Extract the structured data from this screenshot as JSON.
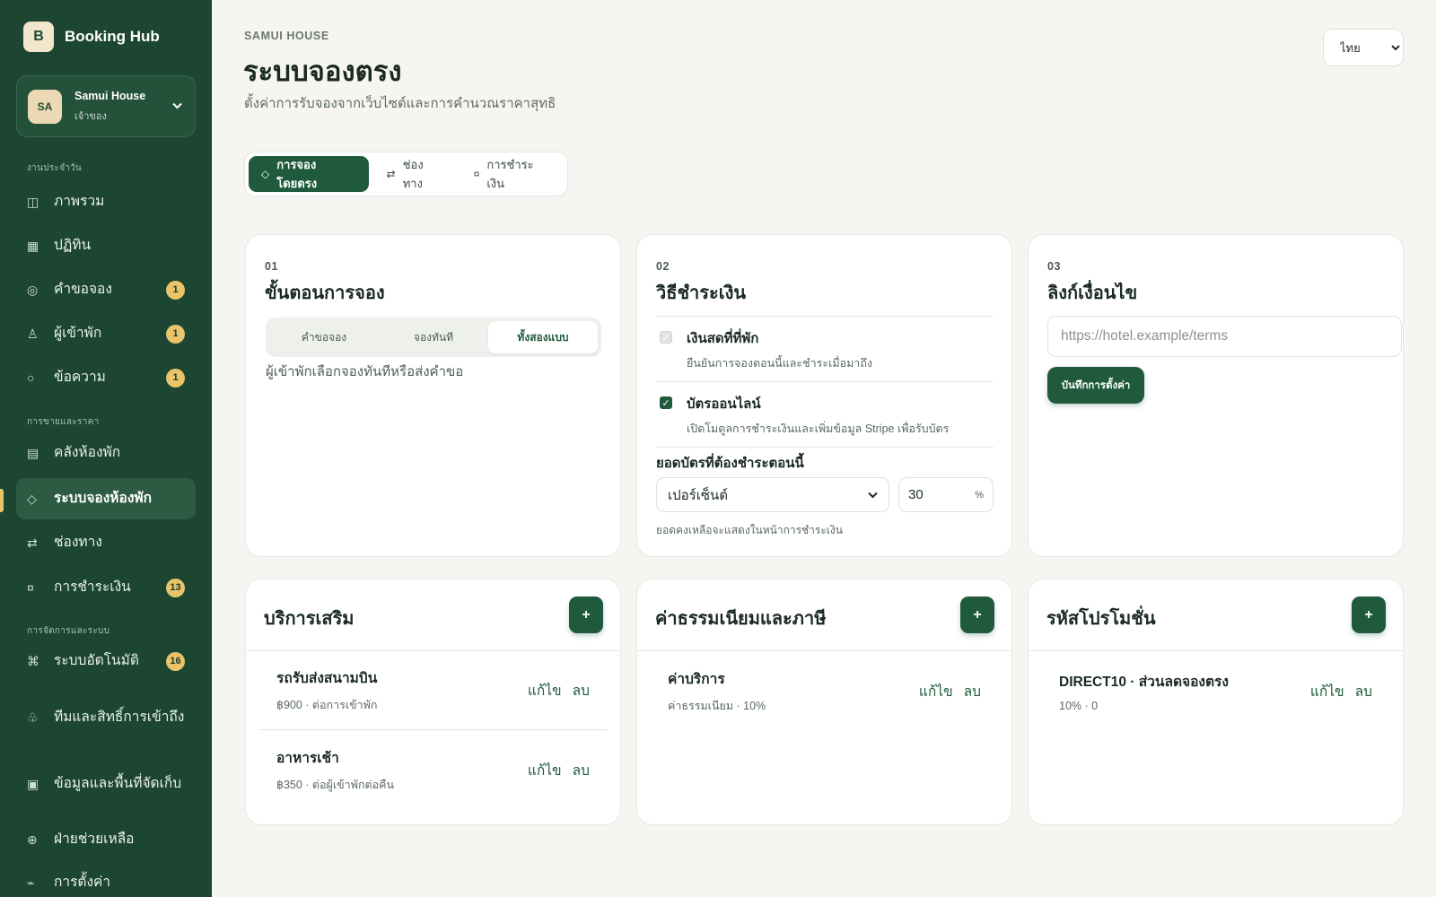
{
  "brand": {
    "logo_letter": "B",
    "name": "Booking Hub"
  },
  "account": {
    "initials": "SA",
    "name": "Samui House",
    "role": "เจ้าของ"
  },
  "sidebar": {
    "sections": [
      "งานประจำวัน",
      "การขายและราคา",
      "การจัดการและระบบ"
    ],
    "items": [
      {
        "label": "ภาพรวม",
        "icon": "◫"
      },
      {
        "label": "ปฏิทิน",
        "icon": "▦"
      },
      {
        "label": "คำขอจอง",
        "icon": "◎",
        "badge": "1"
      },
      {
        "label": "ผู้เข้าพัก",
        "icon": "♙",
        "badge": "1"
      },
      {
        "label": "ข้อความ",
        "icon": "○",
        "badge": "1"
      },
      {
        "label": "คลังห้องพัก",
        "icon": "▤"
      },
      {
        "label": "ระบบจองห้องพัก",
        "icon": "◇"
      },
      {
        "label": "ช่องทาง",
        "icon": "⇄"
      },
      {
        "label": "การชำระเงิน",
        "icon": "¤",
        "badge": "13"
      },
      {
        "label": "ระบบอัตโนมัติ",
        "icon": "⌘",
        "badge": "16"
      },
      {
        "label": "ทีมและสิทธิ์การเข้าถึง",
        "icon": "♧"
      },
      {
        "label": "ข้อมูลและพื้นที่จัดเก็บ",
        "icon": "▣"
      },
      {
        "label": "ฝ่ายช่วยเหลือ",
        "icon": "⊕"
      },
      {
        "label": "การตั้งค่า",
        "icon": "⌁"
      }
    ]
  },
  "header": {
    "eyebrow": "SAMUI HOUSE",
    "title": "ระบบจองตรง",
    "subtitle": "ตั้งค่าการรับจองจากเว็บไซต์และการคำนวณราคาสุทธิ",
    "language": "ไทย"
  },
  "tabs": [
    {
      "label": "การจองโดยตรง",
      "icon": "◇"
    },
    {
      "label": "ช่องทาง",
      "icon": "⇄"
    },
    {
      "label": "การชำระเงิน",
      "icon": "¤"
    }
  ],
  "flow_card": {
    "num": "01",
    "title": "ขั้นตอนการจอง",
    "options": [
      "คำขอจอง",
      "จองทันที",
      "ทั้งสองแบบ"
    ],
    "selected_index": 2,
    "note": "ผู้เข้าพักเลือกจองทันทีหรือส่งคำขอ"
  },
  "payment_card": {
    "num": "02",
    "title": "วิธีชำระเงิน",
    "methods": [
      {
        "name": "เงินสดที่ที่พัก",
        "desc": "ยืนยันการจองตอนนี้และชำระเมื่อมาถึง",
        "checked": true,
        "disabled": true
      },
      {
        "name": "บัตรออนไลน์",
        "desc": "เปิดโมดูลการชำระเงินและเพิ่มข้อมูล Stripe เพื่อรับบัตร",
        "checked": true,
        "disabled": false
      }
    ],
    "due_label": "ยอดบัตรที่ต้องชำระตอนนี้",
    "due_type": "เปอร์เซ็นต์",
    "due_value": "30",
    "due_unit": "%",
    "due_note": "ยอดคงเหลือจะแสดงในหน้าการชำระเงิน"
  },
  "terms_card": {
    "num": "03",
    "title": "ลิงก์เงื่อนไข",
    "placeholder": "https://hotel.example/terms",
    "save_label": "บันทึกการตั้งค่า"
  },
  "lists": [
    {
      "title": "บริการเสริม",
      "add_label": "+",
      "rows": [
        {
          "name": "รถรับส่งสนามบิน",
          "desc": "฿900 · ต่อการเข้าพัก"
        },
        {
          "name": "อาหารเช้า",
          "desc": "฿350 · ต่อผู้เข้าพักต่อคืน"
        }
      ]
    },
    {
      "title": "ค่าธรรมเนียมและภาษี",
      "add_label": "+",
      "rows": [
        {
          "name": "ค่าบริการ",
          "desc": "ค่าธรรมเนียม · 10%"
        }
      ]
    },
    {
      "title": "รหัสโปรโมชั่น",
      "add_label": "+",
      "rows": [
        {
          "name": "DIRECT10 · ส่วนลดจองตรง",
          "desc": "10% · 0"
        }
      ]
    }
  ],
  "row_actions": {
    "edit": "แก้ไข",
    "delete": "ลบ"
  },
  "colors": {
    "sidebar": "#1d4632",
    "accent": "#1f5a3c",
    "badge": "#e9c46a",
    "background": "#f6f5f1"
  }
}
